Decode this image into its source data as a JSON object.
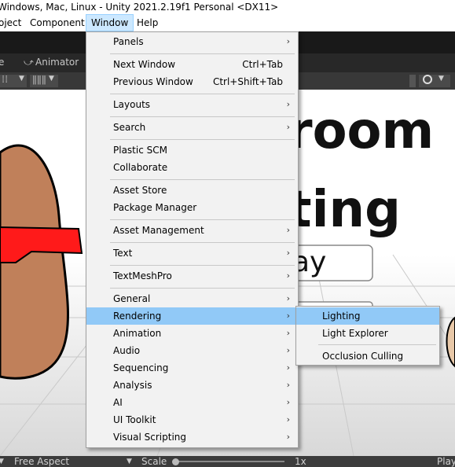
{
  "window": {
    "title": "Windows, Mac, Linux - Unity 2021.2.19f1 Personal <DX11>"
  },
  "menubar": {
    "items": [
      {
        "label": "oject"
      },
      {
        "label": "Component"
      },
      {
        "label": "Window"
      },
      {
        "label": "Help"
      }
    ]
  },
  "tabs": {
    "partial": "e",
    "animator": "Animator"
  },
  "scene": {
    "title_line1": "room",
    "title_line2": "ting",
    "button_text": "ay"
  },
  "statusbar": {
    "aspect": "Free Aspect",
    "scale_label": "Scale",
    "scale_value": "1x",
    "play_partial": "Play"
  },
  "window_menu": {
    "items": [
      {
        "label": "Panels",
        "arrow": "›"
      },
      {
        "label": "Next Window",
        "shortcut": "Ctrl+Tab"
      },
      {
        "label": "Previous Window",
        "shortcut": "Ctrl+Shift+Tab"
      },
      {
        "label": "Layouts",
        "arrow": "›"
      },
      {
        "label": "Search",
        "arrow": "›"
      },
      {
        "label": "Plastic SCM"
      },
      {
        "label": "Collaborate"
      },
      {
        "label": "Asset Store"
      },
      {
        "label": "Package Manager"
      },
      {
        "label": "Asset Management",
        "arrow": "›"
      },
      {
        "label": "Text",
        "arrow": "›"
      },
      {
        "label": "TextMeshPro",
        "arrow": "›"
      },
      {
        "label": "General",
        "arrow": "›"
      },
      {
        "label": "Rendering",
        "arrow": "›"
      },
      {
        "label": "Animation",
        "arrow": "›"
      },
      {
        "label": "Audio",
        "arrow": "›"
      },
      {
        "label": "Sequencing",
        "arrow": "›"
      },
      {
        "label": "Analysis",
        "arrow": "›"
      },
      {
        "label": "AI",
        "arrow": "›"
      },
      {
        "label": "UI Toolkit",
        "arrow": "›"
      },
      {
        "label": "Visual Scripting",
        "arrow": "›"
      }
    ]
  },
  "rendering_submenu": {
    "items": [
      {
        "label": "Lighting"
      },
      {
        "label": "Light Explorer"
      },
      {
        "label": "Occlusion Culling"
      }
    ]
  },
  "colors": {
    "highlight": "#91c9f7",
    "menu_bg": "#f2f2f2",
    "skin": "#c0805a",
    "glasses": "#ff1a1a"
  }
}
